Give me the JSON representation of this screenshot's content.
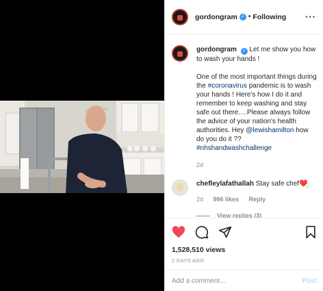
{
  "header": {
    "username": "gordongram",
    "separator": "•",
    "follow_label": "Following",
    "more": "···"
  },
  "caption": {
    "username": "gordongram",
    "line1": "Let me show you how to wash your hands !",
    "p2_a": "One of the most important things during the ",
    "hashtag1": "#coronavirus",
    "p2_b": " pandemic is to wash your hands ! Here's how I do it and remember to keep washing and stay safe out there….Please always follow the advice of your nation's health authorities. Hey ",
    "mention": "@lewishamilton",
    "p2_c": " how do you do it ?? ",
    "hashtag2": "#nhshandwashchallenge",
    "time": "2d"
  },
  "comment": {
    "username": "chefleylafathallah",
    "text": "Stay safe chef❤️",
    "time": "2d",
    "likes": "986 likes",
    "reply": "Reply",
    "view_replies": "View replies (3)"
  },
  "stats": {
    "views": "1,528,510 views",
    "posted": "2 DAYS AGO"
  },
  "add_comment": {
    "placeholder": "Add a comment...",
    "post": "Post"
  },
  "colors": {
    "like_red": "#ed4956",
    "link_blue": "#00376b",
    "verified_blue": "#3897f0"
  },
  "icons": [
    "more-icon",
    "verified-icon",
    "heart-icon",
    "comment-icon",
    "share-icon",
    "bookmark-icon"
  ]
}
